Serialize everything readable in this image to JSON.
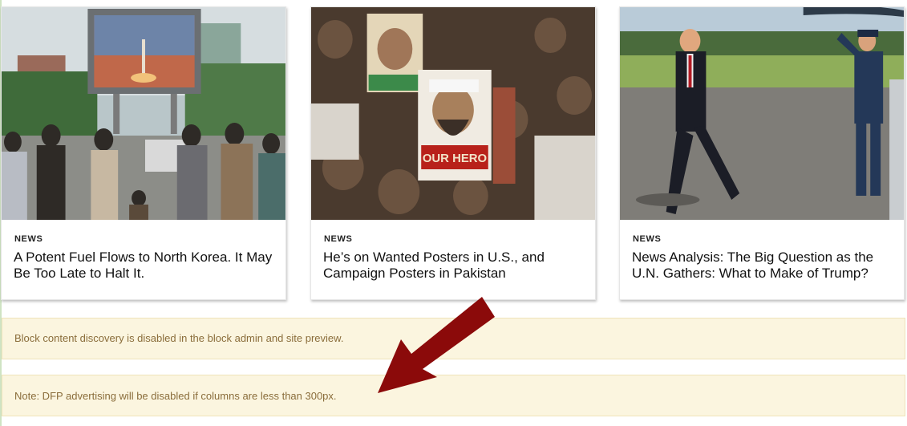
{
  "cards": [
    {
      "kicker": "NEWS",
      "title": "A Potent Fuel Flows to North Korea. It May Be Too Late to Halt It.",
      "image": "photo-crowd-watching-missile-screen"
    },
    {
      "kicker": "NEWS",
      "title": "He’s on Wanted Posters in U.S., and Campaign Posters in Pakistan",
      "image": "photo-protest-crowd-posters",
      "poster_text": "OUR HERO"
    },
    {
      "kicker": "NEWS",
      "title": "News Analysis: The Big Question as the U.N. Gathers: What to Make of Trump?",
      "image": "photo-man-walking-tarmac-saluting-officer"
    }
  ],
  "notices": {
    "block_discovery": "Block content discovery is disabled in the block admin and site preview.",
    "dfp_note": "Note: DFP advertising will be disabled if columns are less than 300px."
  },
  "colors": {
    "notice_bg": "#fbf5df",
    "notice_text": "#8a6d3b",
    "arrow": "#8b0a0a"
  }
}
